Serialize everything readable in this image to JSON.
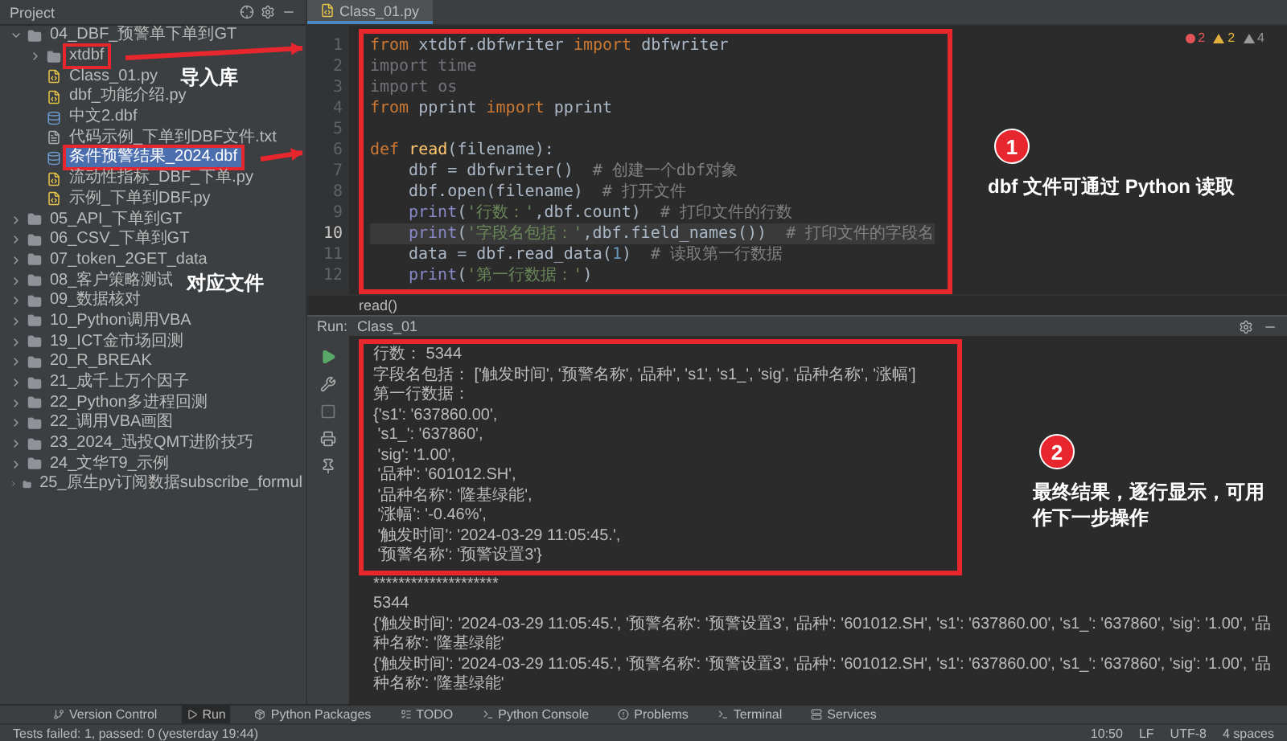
{
  "sidebar": {
    "title": "Project",
    "tree": [
      {
        "label": "04_DBF_预警单下单到GT",
        "kind": "folder",
        "expanded": true,
        "selected": false,
        "annotated": false,
        "children": [
          {
            "label": "xtdbf",
            "kind": "folder",
            "expanded": false,
            "selected": false,
            "annotated": true
          },
          {
            "label": "Class_01.py",
            "kind": "python",
            "selected": false,
            "annotated": false
          },
          {
            "label": "dbf_功能介绍.py",
            "kind": "python",
            "selected": false,
            "annotated": false
          },
          {
            "label": "中文2.dbf",
            "kind": "dbf",
            "selected": false,
            "annotated": false
          },
          {
            "label": "代码示例_下单到DBF文件.txt",
            "kind": "text",
            "selected": false,
            "annotated": false
          },
          {
            "label": "条件预警结果_2024.dbf",
            "kind": "dbf",
            "selected": true,
            "annotated": true
          },
          {
            "label": "流动性指标_DBF_下单.py",
            "kind": "python",
            "selected": false,
            "annotated": false
          },
          {
            "label": "示例_下单到DBF.py",
            "kind": "python",
            "selected": false,
            "annotated": false
          }
        ]
      },
      {
        "label": "05_API_下单到GT",
        "kind": "folder",
        "expanded": false,
        "selected": false,
        "annotated": false
      },
      {
        "label": "06_CSV_下单到GT",
        "kind": "folder",
        "expanded": false,
        "selected": false,
        "annotated": false
      },
      {
        "label": "07_token_2GET_data",
        "kind": "folder",
        "expanded": false,
        "selected": false,
        "annotated": false
      },
      {
        "label": "08_客户策略测试",
        "kind": "folder",
        "expanded": false,
        "selected": false,
        "annotated": false
      },
      {
        "label": "09_数据核对",
        "kind": "folder",
        "expanded": false,
        "selected": false,
        "annotated": false
      },
      {
        "label": "10_Python调用VBA",
        "kind": "folder",
        "expanded": false,
        "selected": false,
        "annotated": false
      },
      {
        "label": "19_ICT金市场回测",
        "kind": "folder",
        "expanded": false,
        "selected": false,
        "annotated": false
      },
      {
        "label": "20_R_BREAK",
        "kind": "folder",
        "expanded": false,
        "selected": false,
        "annotated": false
      },
      {
        "label": "21_成千上万个因子",
        "kind": "folder",
        "expanded": false,
        "selected": false,
        "annotated": false
      },
      {
        "label": "22_Python多进程回测",
        "kind": "folder",
        "expanded": false,
        "selected": false,
        "annotated": false
      },
      {
        "label": "22_调用VBA画图",
        "kind": "folder",
        "expanded": false,
        "selected": false,
        "annotated": false
      },
      {
        "label": "23_2024_迅投QMT进阶技巧",
        "kind": "folder",
        "expanded": false,
        "selected": false,
        "annotated": false
      },
      {
        "label": "24_文华T9_示例",
        "kind": "folder",
        "expanded": false,
        "selected": false,
        "annotated": false
      },
      {
        "label": "25_原生py订阅数据subscribe_formul",
        "kind": "folder",
        "expanded": false,
        "selected": false,
        "annotated": false
      }
    ]
  },
  "editor": {
    "tab": "Class_01.py",
    "inspections": {
      "errors": "2",
      "warnings": "2",
      "weak_warnings": "4"
    },
    "annotated": true,
    "lines": [
      {
        "number": "1",
        "current": false,
        "tokens": [
          {
            "text": "from",
            "kind": "keyword"
          },
          {
            "text": " xtdbf.dbfwriter ",
            "kind": "plain"
          },
          {
            "text": "import",
            "kind": "keyword"
          },
          {
            "text": " dbfwriter",
            "kind": "plain"
          }
        ]
      },
      {
        "number": "2",
        "current": false,
        "tokens": [
          {
            "text": "import time",
            "kind": "unused"
          }
        ]
      },
      {
        "number": "3",
        "current": false,
        "tokens": [
          {
            "text": "import os",
            "kind": "unused"
          }
        ]
      },
      {
        "number": "4",
        "current": false,
        "tokens": [
          {
            "text": "from",
            "kind": "keyword"
          },
          {
            "text": " pprint ",
            "kind": "plain"
          },
          {
            "text": "import",
            "kind": "keyword"
          },
          {
            "text": " pprint",
            "kind": "plain"
          }
        ]
      },
      {
        "number": "5",
        "current": false
      },
      {
        "number": "6",
        "current": false,
        "tokens": [
          {
            "text": "def",
            "kind": "keyword"
          },
          {
            "text": " read",
            "kind": "function"
          },
          {
            "text": "(filename):",
            "kind": "plain"
          }
        ]
      },
      {
        "number": "7",
        "current": false,
        "indented": true,
        "tokens": [
          {
            "text": "dbf = dbfwriter()  ",
            "kind": "plain"
          },
          {
            "text": "# 创建一个dbf对象",
            "kind": "comment"
          }
        ]
      },
      {
        "number": "8",
        "current": false,
        "indented": true,
        "tokens": [
          {
            "text": "dbf.open(filename)  ",
            "kind": "plain"
          },
          {
            "text": "# 打开文件",
            "kind": "comment"
          }
        ]
      },
      {
        "number": "9",
        "current": false,
        "indented": true,
        "tokens": [
          {
            "text": "print",
            "kind": "builtin"
          },
          {
            "text": "(",
            "kind": "plain"
          },
          {
            "text": "'行数：'",
            "kind": "string"
          },
          {
            "text": ",dbf.count)  ",
            "kind": "plain"
          },
          {
            "text": "# 打印文件的行数",
            "kind": "comment"
          }
        ]
      },
      {
        "number": "10",
        "current": true,
        "indented": true,
        "tokens": [
          {
            "text": "print",
            "kind": "builtin"
          },
          {
            "text": "(",
            "kind": "plain"
          },
          {
            "text": "'字段名包括：'",
            "kind": "string"
          },
          {
            "text": ",dbf.field_names())  ",
            "kind": "plain"
          },
          {
            "text": "# 打印文件的字段名",
            "kind": "comment"
          }
        ]
      },
      {
        "number": "11",
        "current": false,
        "indented": true,
        "tokens": [
          {
            "text": "data = dbf.read_data(",
            "kind": "plain"
          },
          {
            "text": "1",
            "kind": "number"
          },
          {
            "text": ")  ",
            "kind": "plain"
          },
          {
            "text": "# 读取第一行数据",
            "kind": "comment"
          }
        ]
      },
      {
        "number": "12",
        "current": false,
        "indented": true,
        "tokens": [
          {
            "text": "print",
            "kind": "builtin"
          },
          {
            "text": "(",
            "kind": "plain"
          },
          {
            "text": "'第一行数据：'",
            "kind": "string"
          },
          {
            "text": ")",
            "kind": "plain"
          }
        ]
      }
    ],
    "breadcrumb": "read()"
  },
  "run": {
    "label": "Run:",
    "tab": "Class_01",
    "boxed_output": [
      "行数： 5344",
      "字段名包括： ['触发时间', '预警名称', '品种', 's1', 's1_', 'sig', '品种名称', '涨幅']",
      "第一行数据：",
      "{'s1': '637860.00',",
      " 's1_': '637860',",
      " 'sig': '1.00',",
      " '品种': '601012.SH',",
      " '品种名称': '隆基绿能',",
      " '涨幅': '-0.46%',",
      " '触发时间': '2024-03-29 11:05:45.',",
      " '预警名称': '预警设置3'}"
    ],
    "output": [
      "********************",
      "5344",
      "{'触发时间': '2024-03-29 11:05:45.', '预警名称': '预警设置3', '品种': '601012.SH', 's1': '637860.00', 's1_': '637860', 'sig': '1.00', '品种名称': '隆基绿能'",
      "{'触发时间': '2024-03-29 11:05:45.', '预警名称': '预警设置3', '品种': '601012.SH', 's1': '637860.00', 's1_': '637860', 'sig': '1.00', '品种名称': '隆基绿能'"
    ]
  },
  "tool_windows": [
    {
      "label": "Version Control",
      "selected": false
    },
    {
      "label": "Run",
      "selected": true
    },
    {
      "label": "Python Packages",
      "selected": false
    },
    {
      "label": "TODO",
      "selected": false
    },
    {
      "label": "Python Console",
      "selected": false
    },
    {
      "label": "Problems",
      "selected": false
    },
    {
      "label": "Terminal",
      "selected": false
    },
    {
      "label": "Services",
      "selected": false
    }
  ],
  "status_bar": {
    "message": "Tests failed: 1, passed: 0 (yesterday 19:44)",
    "items": [
      "10:50",
      "LF",
      "UTF-8",
      "4 spaces"
    ]
  },
  "annotations": {
    "import_label": "导入库",
    "file_label": "对应文件",
    "callouts": [
      {
        "number": "1",
        "text": "dbf 文件可通过 Python 读取"
      },
      {
        "number": "2",
        "text": "最终结果，逐行显示，可用作下一步操作"
      }
    ]
  }
}
